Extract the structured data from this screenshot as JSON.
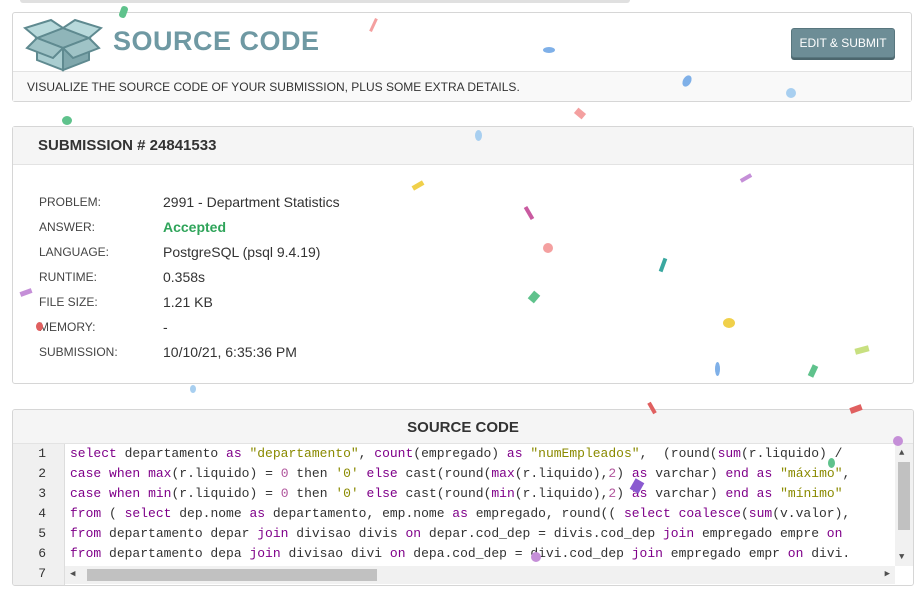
{
  "header": {
    "title": "SOURCE CODE",
    "submit_label": "EDIT & SUBMIT",
    "subtitle": "VISUALIZE THE SOURCE CODE OF YOUR SUBMISSION, PLUS SOME EXTRA DETAILS."
  },
  "submission": {
    "title": "SUBMISSION # 24841533",
    "rows": [
      {
        "label": "PROBLEM:",
        "value": "2991 - Department Statistics"
      },
      {
        "label": "ANSWER:",
        "value": "Accepted"
      },
      {
        "label": "LANGUAGE:",
        "value": "PostgreSQL (psql 9.4.19)"
      },
      {
        "label": "RUNTIME:",
        "value": "0.358s"
      },
      {
        "label": "FILE SIZE:",
        "value": "1.21 KB"
      },
      {
        "label": "MEMORY:",
        "value": "-"
      },
      {
        "label": "SUBMISSION:",
        "value": "10/10/21, 6:35:36 PM"
      }
    ]
  },
  "code": {
    "title": "SOURCE CODE",
    "line_numbers": [
      "1",
      "2",
      "3",
      "4",
      "5",
      "6",
      "7"
    ],
    "lines": [
      [
        [
          "kw",
          "select"
        ],
        [
          "p",
          " departamento "
        ],
        [
          "kw",
          "as"
        ],
        [
          "p",
          " "
        ],
        [
          "str",
          "\"departamento\""
        ],
        [
          "p",
          ", "
        ],
        [
          "kw",
          "count"
        ],
        [
          "p",
          "(empregado) "
        ],
        [
          "kw",
          "as"
        ],
        [
          "p",
          " "
        ],
        [
          "str",
          "\"numEmpleados\""
        ],
        [
          "p",
          ",  (round("
        ],
        [
          "kw",
          "sum"
        ],
        [
          "p",
          "(r.liquido) /"
        ]
      ],
      [
        [
          "kw",
          "case"
        ],
        [
          "p",
          " "
        ],
        [
          "kw",
          "when"
        ],
        [
          "p",
          " "
        ],
        [
          "kw",
          "max"
        ],
        [
          "p",
          "(r.liquido) = "
        ],
        [
          "num",
          "0"
        ],
        [
          "p",
          " then "
        ],
        [
          "str",
          "'0'"
        ],
        [
          "p",
          " "
        ],
        [
          "kw",
          "else"
        ],
        [
          "p",
          " cast(round("
        ],
        [
          "kw",
          "max"
        ],
        [
          "p",
          "(r.liquido),"
        ],
        [
          "num",
          "2"
        ],
        [
          "p",
          ") "
        ],
        [
          "kw",
          "as"
        ],
        [
          "p",
          " varchar) "
        ],
        [
          "kw",
          "end"
        ],
        [
          "p",
          " "
        ],
        [
          "kw",
          "as"
        ],
        [
          "p",
          " "
        ],
        [
          "str",
          "\"máximo\""
        ],
        [
          "p",
          ","
        ]
      ],
      [
        [
          "kw",
          "case"
        ],
        [
          "p",
          " "
        ],
        [
          "kw",
          "when"
        ],
        [
          "p",
          " "
        ],
        [
          "kw",
          "min"
        ],
        [
          "p",
          "(r.liquido) = "
        ],
        [
          "num",
          "0"
        ],
        [
          "p",
          " then "
        ],
        [
          "str",
          "'0'"
        ],
        [
          "p",
          " "
        ],
        [
          "kw",
          "else"
        ],
        [
          "p",
          " cast(round("
        ],
        [
          "kw",
          "min"
        ],
        [
          "p",
          "(r.liquido),"
        ],
        [
          "num",
          "2"
        ],
        [
          "p",
          ") "
        ],
        [
          "kw",
          "as"
        ],
        [
          "p",
          " varchar) "
        ],
        [
          "kw",
          "end"
        ],
        [
          "p",
          " "
        ],
        [
          "kw",
          "as"
        ],
        [
          "p",
          " "
        ],
        [
          "str",
          "\"mínimo\""
        ]
      ],
      [
        [
          "kw",
          "from"
        ],
        [
          "p",
          " ( "
        ],
        [
          "kw",
          "select"
        ],
        [
          "p",
          " dep.nome "
        ],
        [
          "kw",
          "as"
        ],
        [
          "p",
          " departamento, emp.nome "
        ],
        [
          "kw",
          "as"
        ],
        [
          "p",
          " empregado, round(( "
        ],
        [
          "kw",
          "select"
        ],
        [
          "p",
          " "
        ],
        [
          "kw",
          "coalesce"
        ],
        [
          "p",
          "("
        ],
        [
          "kw",
          "sum"
        ],
        [
          "p",
          "(v.valor),"
        ]
      ],
      [
        [
          "kw",
          "from"
        ],
        [
          "p",
          " departamento depar "
        ],
        [
          "kw",
          "join"
        ],
        [
          "p",
          " divisao divis "
        ],
        [
          "kw",
          "on"
        ],
        [
          "p",
          " depar.cod_dep = divis.cod_dep "
        ],
        [
          "kw",
          "join"
        ],
        [
          "p",
          " empregado empre "
        ],
        [
          "kw",
          "on"
        ]
      ],
      [
        [
          "kw",
          "from"
        ],
        [
          "p",
          " departamento depa "
        ],
        [
          "kw",
          "join"
        ],
        [
          "p",
          " divisao divi "
        ],
        [
          "kw",
          "on"
        ],
        [
          "p",
          " depa.cod_dep = divi.cod_dep "
        ],
        [
          "kw",
          "join"
        ],
        [
          "p",
          " empregado empr "
        ],
        [
          "kw",
          "on"
        ],
        [
          "p",
          " divi."
        ]
      ],
      [
        [
          "p",
          ""
        ]
      ]
    ]
  },
  "colors": {
    "title_teal": "#6f99a3",
    "button_bg": "#6d8d96",
    "accepted_green": "#2fa45a",
    "keyword_purple": "#7f0089",
    "string_olive": "#8a8a00"
  }
}
